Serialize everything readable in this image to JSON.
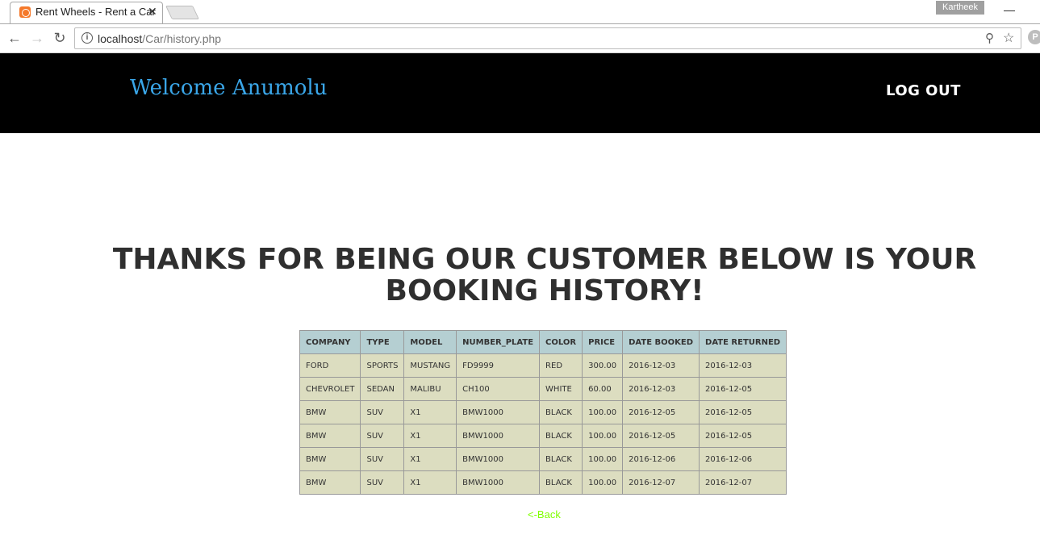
{
  "browser": {
    "tab_title": "Rent Wheels - Rent a Car",
    "tab_close": "✕",
    "profile": "Kartheek",
    "url_host": "localhost",
    "url_path": "/Car/history.php",
    "icons": [
      "back-arrow-icon",
      "forward-arrow-icon",
      "reload-icon",
      "info-icon",
      "zoom-icon",
      "star-icon"
    ]
  },
  "header": {
    "welcome": "Welcome Anumolu",
    "logout": "LOG OUT"
  },
  "headline": "THANKS FOR BEING OUR CUSTOMER BELOW IS YOUR BOOKING HISTORY!",
  "table": {
    "columns": [
      "COMPANY",
      "TYPE",
      "MODEL",
      "NUMBER_PLATE",
      "COLOR",
      "PRICE",
      "DATE BOOKED",
      "DATE RETURNED"
    ],
    "rows": [
      [
        "FORD",
        "SPORTS",
        "MUSTANG",
        "FD9999",
        "RED",
        "300.00",
        "2016-12-03",
        "2016-12-03"
      ],
      [
        "CHEVROLET",
        "SEDAN",
        "MALIBU",
        "CH100",
        "WHITE",
        "60.00",
        "2016-12-03",
        "2016-12-05"
      ],
      [
        "BMW",
        "SUV",
        "X1",
        "BMW1000",
        "BLACK",
        "100.00",
        "2016-12-05",
        "2016-12-05"
      ],
      [
        "BMW",
        "SUV",
        "X1",
        "BMW1000",
        "BLACK",
        "100.00",
        "2016-12-05",
        "2016-12-05"
      ],
      [
        "BMW",
        "SUV",
        "X1",
        "BMW1000",
        "BLACK",
        "100.00",
        "2016-12-06",
        "2016-12-06"
      ],
      [
        "BMW",
        "SUV",
        "X1",
        "BMW1000",
        "BLACK",
        "100.00",
        "2016-12-07",
        "2016-12-07"
      ]
    ]
  },
  "back_link": "<-Back",
  "colors": {
    "header_bg": "#000000",
    "welcome": "#3aa6e8",
    "table_header": "#b5cfd2",
    "table_cell": "#dcddc0",
    "back_link": "#7fff00"
  }
}
